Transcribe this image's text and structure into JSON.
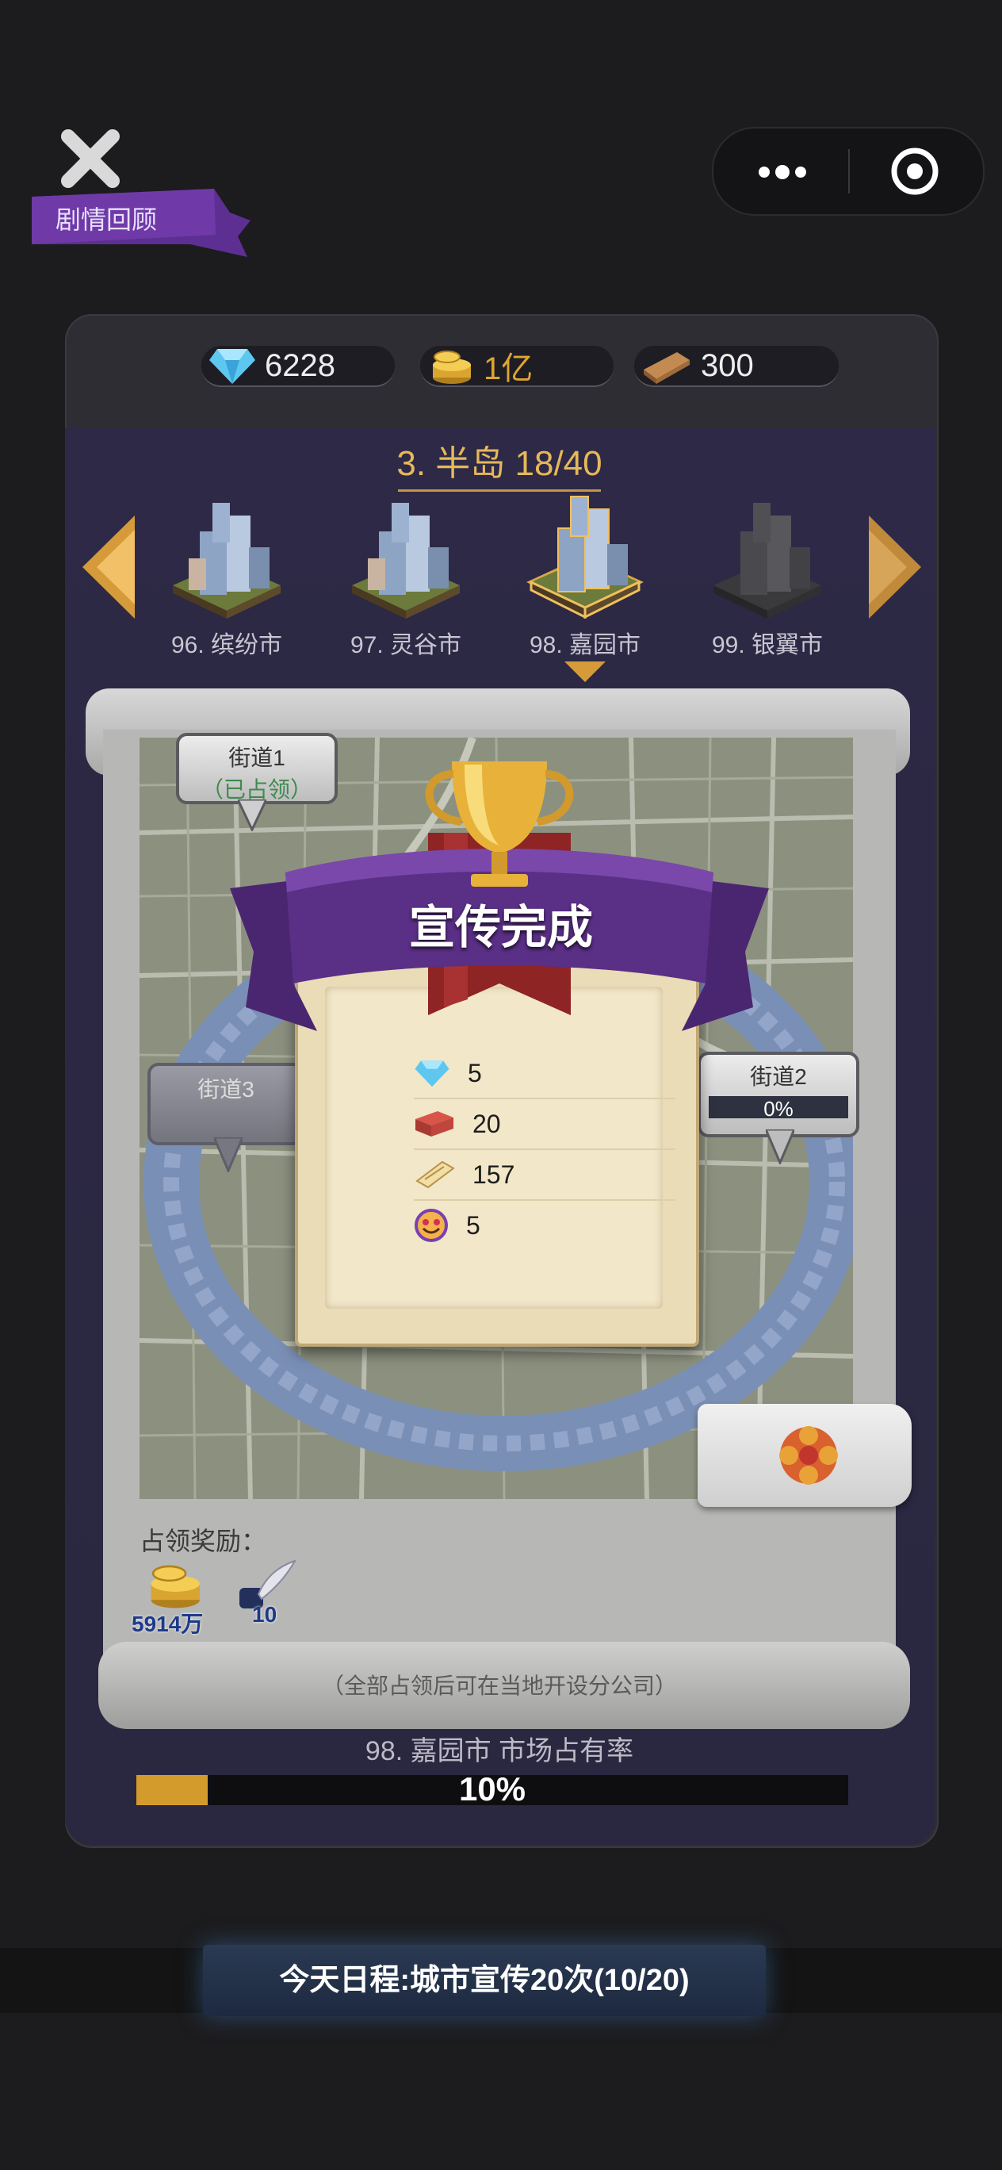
{
  "top_bar": {
    "story_review": "剧情回顾",
    "more_icon": "more-dots-icon",
    "target_icon": "record-target-icon"
  },
  "resources": {
    "diamonds": "6228",
    "gold": "1亿",
    "materials": "300"
  },
  "region": {
    "title": "3. 半岛 18/40"
  },
  "cities": [
    {
      "label": "96. 缤纷市",
      "state": "unlocked"
    },
    {
      "label": "97. 灵谷市",
      "state": "unlocked"
    },
    {
      "label": "98. 嘉园市",
      "state": "selected"
    },
    {
      "label": "99. 银翼市",
      "state": "locked"
    }
  ],
  "streets": {
    "street1": {
      "name": "街道1",
      "status": "（已占领）"
    },
    "street2": {
      "name": "街道2",
      "progress_text": "0%",
      "progress": 0
    },
    "street3": {
      "name": "街道3"
    }
  },
  "popup": {
    "title": "宣传完成",
    "rewards": [
      {
        "icon": "diamond-icon",
        "value": "5"
      },
      {
        "icon": "brick-icon",
        "value": "20"
      },
      {
        "icon": "ticket-icon",
        "value": "157"
      },
      {
        "icon": "smiley-icon",
        "value": "5"
      }
    ]
  },
  "occupy_bonus": {
    "label": "占领奖励：",
    "gold": "5914万",
    "ink": "10"
  },
  "footnote": "（全部占领后可在当地开设分公司）",
  "market_share": {
    "label": "98. 嘉园市 市场占有率",
    "value_text": "10%",
    "value": 0.1
  },
  "schedule": "今天日程:城市宣传20次(10/20)",
  "colors": {
    "accent_gold": "#e6b85a",
    "ribbon_purple": "#5a2f86",
    "progress_fill": "#d39b2c"
  }
}
